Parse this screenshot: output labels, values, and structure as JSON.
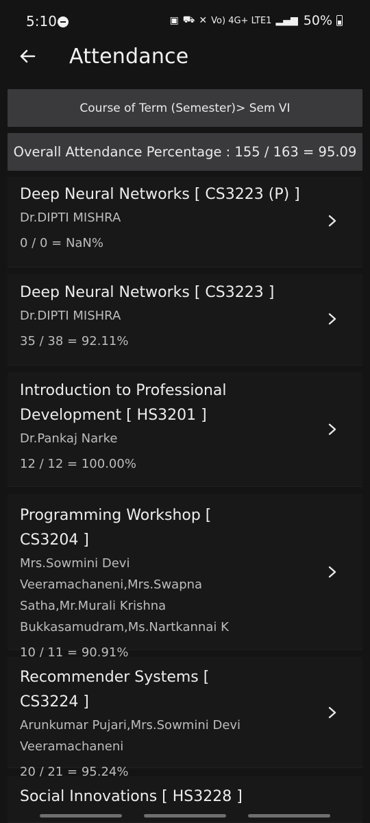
{
  "status": {
    "time": "5:10",
    "network": "Vo) 4G+ LTE1",
    "battery": "50%"
  },
  "app_bar": {
    "title": "Attendance"
  },
  "term_banner": "Course of Term (Semester)> Sem VI",
  "overall_banner": "Overall Attendance Percentage : 155 / 163 = 95.09",
  "courses": [
    {
      "title": "Deep Neural Networks [ CS3223 (P) ]",
      "faculty": "Dr.DIPTI  MISHRA",
      "attendance": "0 / 0 = NaN%"
    },
    {
      "title": "Deep Neural Networks [ CS3223 ]",
      "faculty": "Dr.DIPTI  MISHRA",
      "attendance": "35 / 38 = 92.11%"
    },
    {
      "title": "Introduction to Professional Development [ HS3201 ]",
      "faculty": "Dr.Pankaj  Narke",
      "attendance": "12 / 12 = 100.00%"
    },
    {
      "title": "Programming Workshop [ CS3204 ]",
      "faculty": "Mrs.Sowmini Devi Veeramachaneni,Mrs.Swapna Satha,Mr.Murali Krishna Bukkasamudram,Ms.Nartkannai  K",
      "attendance": "10 / 11 = 90.91%"
    },
    {
      "title": "Recommender Systems [ CS3224 ]",
      "faculty": "Arunkumar  Pujari,Mrs.Sowmini Devi Veeramachaneni",
      "attendance": "20 / 21 = 95.24%"
    },
    {
      "title": "Social Innovations [ HS3228 ]",
      "faculty": "",
      "attendance": ""
    }
  ]
}
